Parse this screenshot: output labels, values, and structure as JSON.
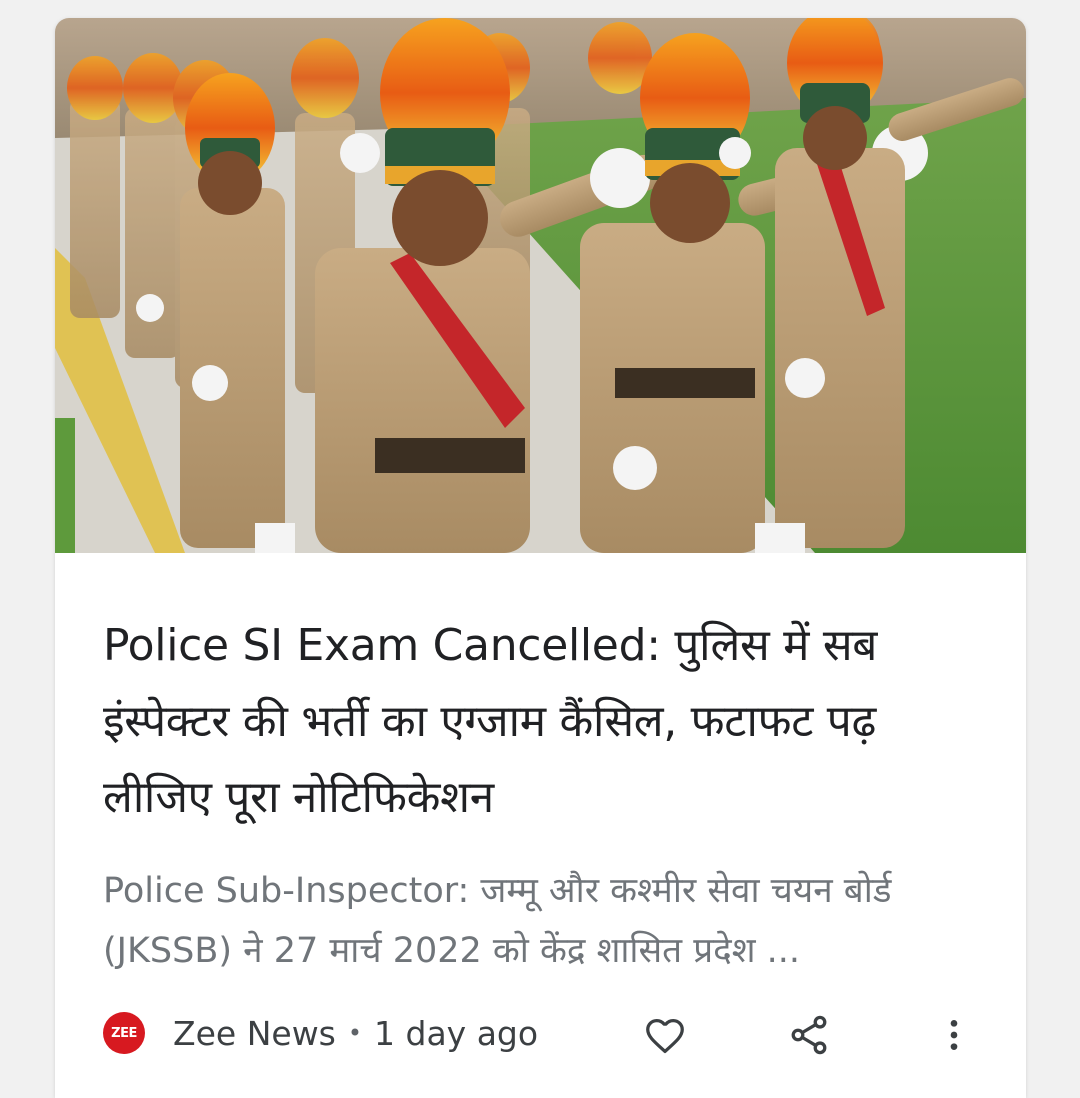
{
  "card": {
    "headline": "Police SI Exam Cancelled: पुलिस में सब इंस्पेक्टर की भर्ती का एग्जाम कैंसिल, फटाफट पढ़ लीजिए पूरा नोटिफिकेशन",
    "snippet": "Police Sub-Inspector: जम्मू और कश्मीर सेवा चयन बोर्ड (JKSSB) ने 27 मार्च 2022 को केंद्र शासित प्रदेश ...",
    "image_icon": "marching-police-photo"
  },
  "source": {
    "logo_text": "ZEE",
    "name": "Zee News",
    "separator": "•",
    "time": "1 day ago",
    "logo_color": "#d71920"
  },
  "actions": {
    "like_icon": "heart-outline-icon",
    "share_icon": "share-icon",
    "more_icon": "more-vert-icon"
  }
}
